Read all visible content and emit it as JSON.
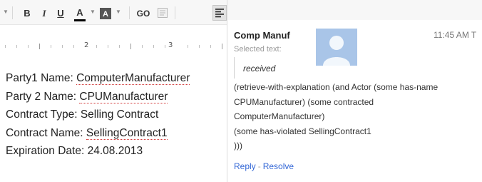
{
  "toolbar": {
    "bold_label": "B",
    "italic_label": "I",
    "underline_label": "U",
    "text_color_label": "A",
    "highlight_label": "A",
    "link_label": "GO"
  },
  "ruler": {
    "numbers": [
      "2",
      "3"
    ]
  },
  "document": {
    "lines": [
      {
        "label": "Party1 Name: ",
        "value": "ComputerManufacturer"
      },
      {
        "label": "Party 2 Name: ",
        "value": "CPUManufacturer"
      },
      {
        "label": "Contract Type: ",
        "value": "Selling Contract"
      },
      {
        "label": "Contract Name: ",
        "value": "SellingContract1"
      },
      {
        "label": "Expiration Date: ",
        "value": "24.08.2013"
      }
    ]
  },
  "comment": {
    "author": "Comp Manuf",
    "time": "11:45 AM T",
    "selected_label": "Selected text:",
    "selected_text": "received",
    "body_lines": [
      "(retrieve-with-explanation (and Actor (some has-name",
      "CPUManufacturer) (some contracted",
      "ComputerManufacturer)",
      "(some has-violated SellingContract1",
      ")))"
    ],
    "reply_label": "Reply",
    "separator": "-",
    "resolve_label": "Resolve"
  },
  "colors": {
    "link": "#3367d6",
    "spelling_underline": "#d23b3b",
    "avatar_bg": "#a9c5e8"
  }
}
